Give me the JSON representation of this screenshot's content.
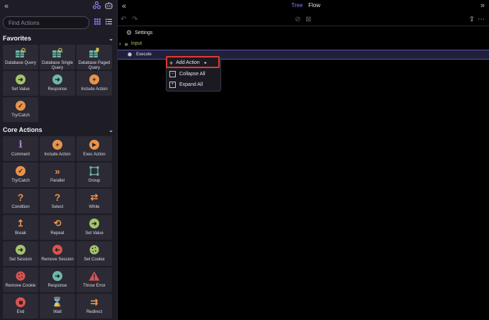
{
  "sidebar": {
    "search_placeholder": "Find Actions",
    "favorites": {
      "title": "Favorites",
      "items": [
        {
          "label": "Database Query",
          "icon": "database-search-icon",
          "color": "#6fb8a8"
        },
        {
          "label": "Database Single Query",
          "icon": "database-search-icon",
          "color": "#6fb8a8"
        },
        {
          "label": "Database Paged Query",
          "icon": "database-paged-icon",
          "color": "#6fb8a8"
        },
        {
          "label": "Set Value",
          "icon": "arrow-right-circle-icon",
          "color": "#a3c26a"
        },
        {
          "label": "Response",
          "icon": "arrow-right-circle-icon",
          "color": "#6fb8a8"
        },
        {
          "label": "Include Action",
          "icon": "plus-circle-icon",
          "color": "#e8934a"
        },
        {
          "label": "Try/Catch",
          "icon": "check-circle-icon",
          "color": "#e8934a"
        }
      ]
    },
    "core": {
      "title": "Core Actions",
      "items": [
        {
          "label": "Comment",
          "icon": "info-icon",
          "color": "#b47cd6"
        },
        {
          "label": "Include Action",
          "icon": "plus-circle-icon",
          "color": "#e8934a"
        },
        {
          "label": "Exec Action",
          "icon": "play-circle-icon",
          "color": "#e8934a"
        },
        {
          "label": "Try/Catch",
          "icon": "check-circle-icon",
          "color": "#e8934a"
        },
        {
          "label": "Parallel",
          "icon": "double-chevron-icon",
          "color": "#e8934a"
        },
        {
          "label": "Group",
          "icon": "group-icon",
          "color": "#6fb8a8"
        },
        {
          "label": "Condition",
          "icon": "question-icon",
          "color": "#e8934a"
        },
        {
          "label": "Select",
          "icon": "question-icon",
          "color": "#e8934a"
        },
        {
          "label": "While",
          "icon": "loop-icon",
          "color": "#e8934a"
        },
        {
          "label": "Break",
          "icon": "break-arrow-icon",
          "color": "#e8934a"
        },
        {
          "label": "Repeat",
          "icon": "repeat-icon",
          "color": "#e8934a"
        },
        {
          "label": "Set Value",
          "icon": "arrow-right-circle-icon",
          "color": "#a3c26a"
        },
        {
          "label": "Set Session",
          "icon": "arrow-right-circle-icon",
          "color": "#a3c26a"
        },
        {
          "label": "Remove Session",
          "icon": "arrow-left-circle-icon",
          "color": "#d9534f"
        },
        {
          "label": "Set Cookie",
          "icon": "cookie-icon",
          "color": "#a3c26a"
        },
        {
          "label": "Remove Cookie",
          "icon": "cookie-icon",
          "color": "#d9534f"
        },
        {
          "label": "Response",
          "icon": "arrow-right-circle-icon",
          "color": "#6fb8a8"
        },
        {
          "label": "Throw Error",
          "icon": "warning-icon",
          "color": "#d9534f"
        },
        {
          "label": "End",
          "icon": "stop-circle-icon",
          "color": "#d9534f"
        },
        {
          "label": "Wait",
          "icon": "hourglass-icon",
          "color": "#e8934a"
        },
        {
          "label": "Redirect",
          "icon": "redirect-icon",
          "color": "#e8934a"
        }
      ]
    }
  },
  "header": {
    "tab_tree": "Tree",
    "tab_flow": "Flow"
  },
  "tree": {
    "settings": "Settings",
    "input": "Input",
    "execute": "Execute"
  },
  "context_menu": {
    "add_action": "Add Action",
    "collapse_all": "Collapse All",
    "expand_all": "Expand All"
  }
}
